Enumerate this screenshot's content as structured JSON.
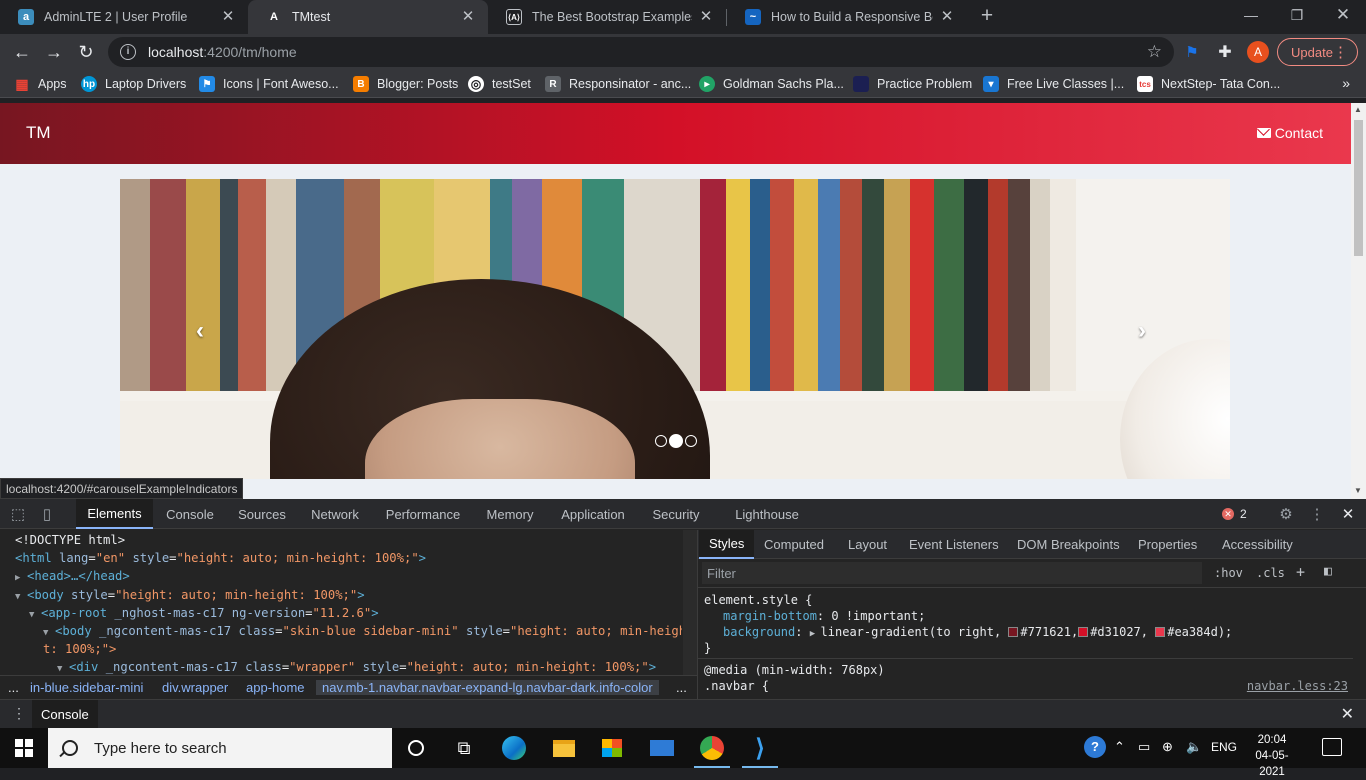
{
  "browser": {
    "tabs": [
      {
        "title": "AdminLTE 2 | User Profile",
        "favicon": "adminlte-icon"
      },
      {
        "title": "TMtest",
        "favicon": "angular-icon"
      },
      {
        "title": "The Best Bootstrap Examples",
        "favicon": "mdb-icon"
      },
      {
        "title": "How to Build a Responsive Boots",
        "favicon": "tutorial-site-icon"
      }
    ],
    "active_tab_index": 1,
    "url_host": "localhost",
    "url_path": ":4200/tm/home",
    "profile_initial": "A",
    "update_label": "Update",
    "bookmarks": [
      {
        "label": "Apps",
        "icon": "apps-grid-icon",
        "color": "#e94235"
      },
      {
        "label": "Laptop Drivers",
        "icon": "hp-icon",
        "color": "#0096d6"
      },
      {
        "label": "Icons | Font Aweso...",
        "icon": "font-awesome-flag-icon",
        "color": "#228ae6"
      },
      {
        "label": "Blogger: Posts",
        "icon": "blogger-icon",
        "color": "#f57d00"
      },
      {
        "label": "testSet",
        "icon": "globe-icon",
        "color": "#ffffff"
      },
      {
        "label": "Responsinator - anc...",
        "icon": "responsinator-icon",
        "color": "#5f6368"
      },
      {
        "label": "Goldman Sachs Pla...",
        "icon": "goldman-sachs-icon",
        "color": "#21a366"
      },
      {
        "label": "Practice Problem",
        "icon": "practice-icon",
        "color": "#1b1f52"
      },
      {
        "label": "Free Live Classes |...",
        "icon": "live-classes-icon",
        "color": "#1976d2"
      },
      {
        "label": "NextStep- Tata Con...",
        "icon": "tcs-icon",
        "color": "#e53935"
      }
    ]
  },
  "page": {
    "brand": "TM",
    "contact_label": "Contact",
    "navbar_colors": [
      "#771621",
      "#d31027",
      "#ea384d"
    ],
    "carousel": {
      "slides": 3,
      "active_index": 1
    }
  },
  "status_url": "localhost:4200/#carouselExampleIndicators",
  "devtools": {
    "tabs": [
      "Elements",
      "Console",
      "Sources",
      "Network",
      "Performance",
      "Memory",
      "Application",
      "Security",
      "Lighthouse"
    ],
    "active_tab": "Elements",
    "error_count": "2",
    "dom_lines": [
      {
        "doctype": "<!DOCTYPE html>"
      },
      {
        "tag": "html",
        "attrs": [
          [
            "lang",
            "en"
          ],
          [
            "style",
            "height: auto; min-height: 100%;"
          ]
        ]
      },
      {
        "collapsed": "<head>…</head>"
      },
      {
        "tag": "body",
        "attrs": [
          [
            "style",
            "height: auto; min-height: 100%;"
          ]
        ]
      },
      {
        "tag": "app-root",
        "attrs": [
          [
            "_nghost-mas-c17",
            ""
          ],
          [
            "ng-version",
            "11.2.6"
          ]
        ]
      },
      {
        "tag": "body",
        "attrs": [
          [
            "_ngcontent-mas-c17",
            ""
          ],
          [
            "class",
            "skin-blue sidebar-mini"
          ],
          [
            "style",
            "height: auto; min-heigh"
          ]
        ]
      },
      {
        "continuation": "t: 100%;\">"
      },
      {
        "tag": "div",
        "attrs": [
          [
            "_ngcontent-mas-c17",
            ""
          ],
          [
            "class",
            "wrapper"
          ],
          [
            "style",
            "height: auto; min-height: 100%;"
          ]
        ]
      }
    ],
    "breadcrumbs": [
      "...",
      "in-blue.sidebar-mini",
      "div.wrapper",
      "app-home",
      "nav.mb-1.navbar.navbar-expand-lg.navbar-dark.info-color",
      "..."
    ],
    "styles_tabs": [
      "Styles",
      "Computed",
      "Layout",
      "Event Listeners",
      "DOM Breakpoints",
      "Properties",
      "Accessibility"
    ],
    "filter_placeholder": "Filter",
    "hov_label": ":hov",
    "cls_label": ".cls",
    "element_style": {
      "selector": "element.style {",
      "margin_prop": "margin-bottom",
      "margin_val": "0 !important;",
      "bg_prop": "background",
      "bg_val_prefix": "linear-gradient(to right, ",
      "colors": [
        "#771621",
        "#d31027",
        "#ea384d"
      ],
      "close": "}"
    },
    "media_rule": "@media (min-width: 768px)",
    "navbar_selector": ".navbar {",
    "source_link": "navbar.less:23",
    "drawer_tab": "Console"
  },
  "taskbar": {
    "search_placeholder": "Type here to search",
    "language": "ENG",
    "time": "20:04",
    "date": "04-05-2021",
    "apps": [
      "task-view-icon",
      "edge-icon",
      "file-explorer-icon",
      "store-icon",
      "mail-icon",
      "chrome-icon",
      "vscode-icon"
    ]
  }
}
